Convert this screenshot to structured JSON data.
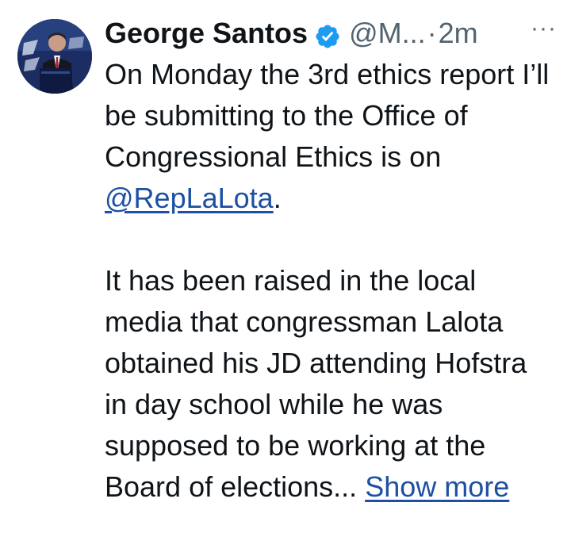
{
  "tweet": {
    "author_name": "George Santos",
    "handle": "@M...",
    "separator": "·",
    "time": "2m",
    "more_label": "···",
    "verified_icon": "verified-badge-icon",
    "avatar_icon": "profile-avatar",
    "paragraph1": {
      "before_mention": "On Monday the 3rd ethics report I’ll be submitting to the Office of Congressional Ethics is on ",
      "mention": "@RepLaLota",
      "after_mention": "."
    },
    "paragraph2": {
      "text": "It has been raised in the local media that congressman Lalota obtained his JD attending Hofstra in day school while he was supposed to be working at the Board of elections... ",
      "show_more": "Show more"
    },
    "colors": {
      "text": "#0f1419",
      "secondary": "#536471",
      "link": "#1d4fa3",
      "verified": "#1d9bf0"
    }
  }
}
